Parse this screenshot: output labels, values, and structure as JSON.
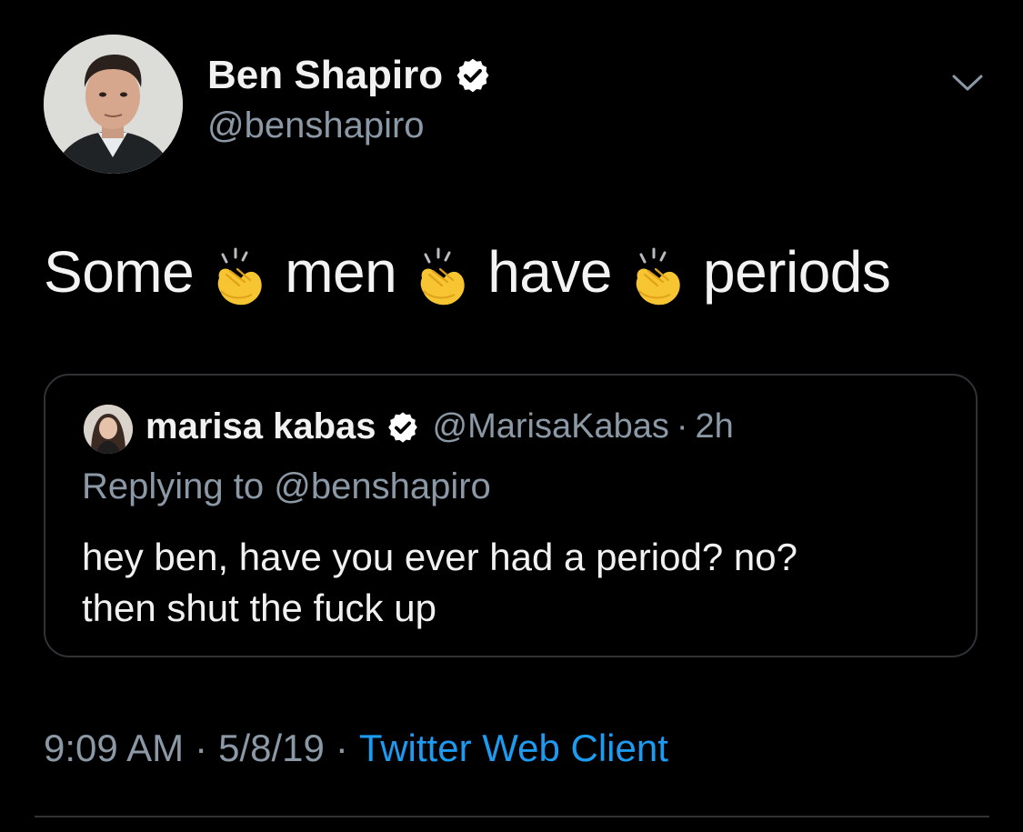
{
  "tweet": {
    "author": {
      "name": "Ben Shapiro",
      "handle": "@benshapiro",
      "verified_icon": "verified-badge-icon",
      "avatar_icon": "profile-avatar"
    },
    "menu_icon": "chevron-down-icon",
    "text_words": [
      "Some",
      "men",
      "have",
      "periods"
    ],
    "separator_emoji": "clapping-hands-emoji",
    "quote": {
      "name": "marisa kabas",
      "handle": "@MarisaKabas",
      "dot": "·",
      "time": "2h",
      "replying_to": "Replying to @benshapiro",
      "body_line1": "hey ben, have you ever had a period?  no?",
      "body_line2": "then shut the fuck up"
    },
    "meta": {
      "time": "9:09 AM",
      "sep1": "·",
      "date": "5/8/19",
      "sep2": "·",
      "source": "Twitter Web Client"
    }
  },
  "colors": {
    "background": "#000000",
    "primary_text": "#f1f1f1",
    "secondary_text": "#8b98a5",
    "link": "#1d9bf0",
    "border": "#2f3336",
    "clap_yellow": "#f7c531"
  }
}
